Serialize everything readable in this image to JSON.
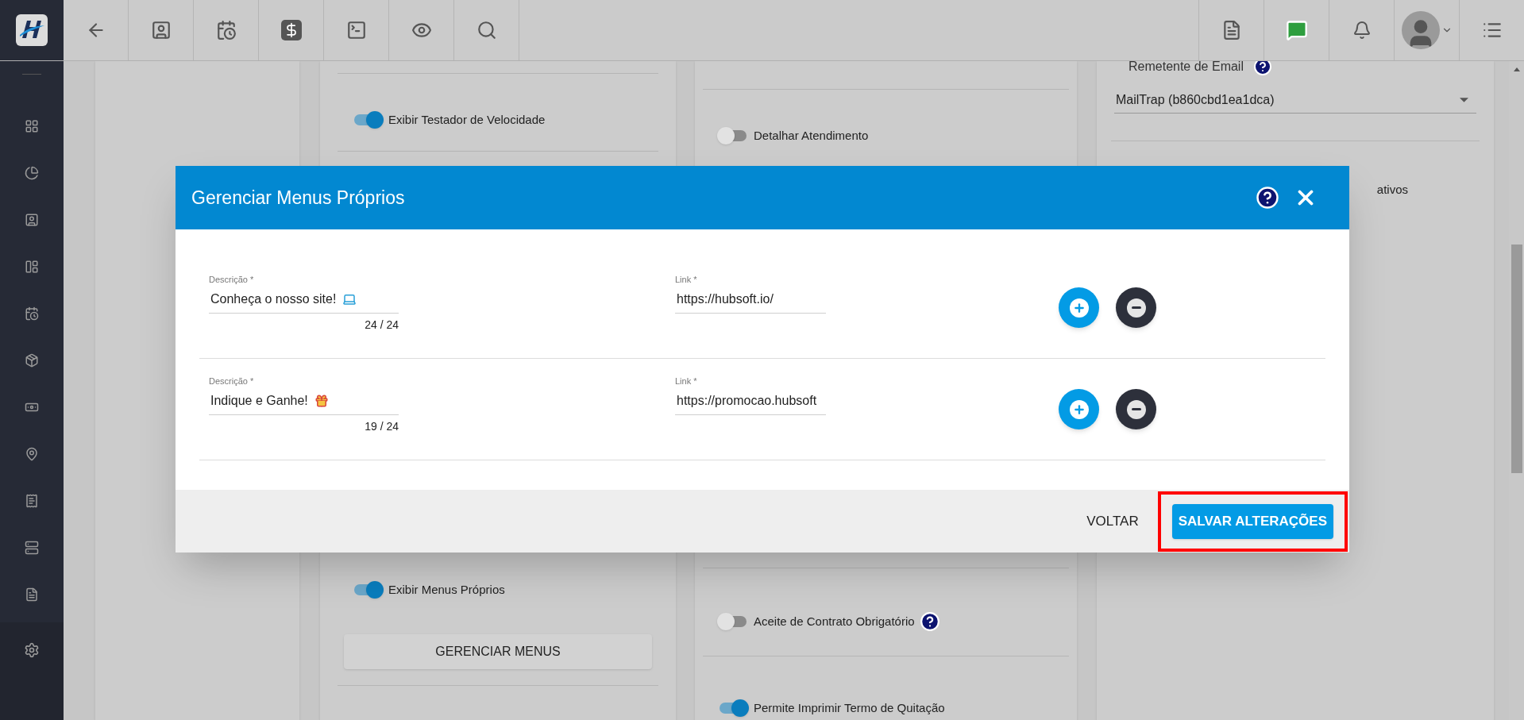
{
  "background": {
    "toggles": [
      {
        "label": "Exibir Testador de Velocidade",
        "on": true
      },
      {
        "label": "Detalhar Atendimento",
        "on": false
      },
      {
        "label": "Exibir Menus Próprios",
        "on": true
      },
      {
        "label": "Aceite de Contrato Obrigatório",
        "on": false,
        "help": true
      },
      {
        "label": "Permite Imprimir Termo de Quitação",
        "on": true
      }
    ],
    "manage_button": "GERENCIAR MENUS",
    "email_sender": {
      "label": "Remetente de Email",
      "value": "MailTrap (b860cbd1ea1dca)"
    },
    "partial_text": "ativos"
  },
  "dialog": {
    "title": "Gerenciar Menus Próprios",
    "rows": [
      {
        "description_label": "Descrição *",
        "description": "Conheça o nosso site!",
        "kind": "laptop",
        "counter": "24 / 24",
        "link_label": "Link *",
        "link": "https://hubsoft.io/"
      },
      {
        "description_label": "Descrição *",
        "description": "Indique e Ganhe!",
        "kind": "gift",
        "counter": "19 / 24",
        "link_label": "Link *",
        "link": "https://promocao.hubsoft"
      }
    ],
    "cancel": "VOLTAR",
    "save": {
      "label": "SALVAR ALTERAÇÕES",
      "highlighted": true
    }
  }
}
